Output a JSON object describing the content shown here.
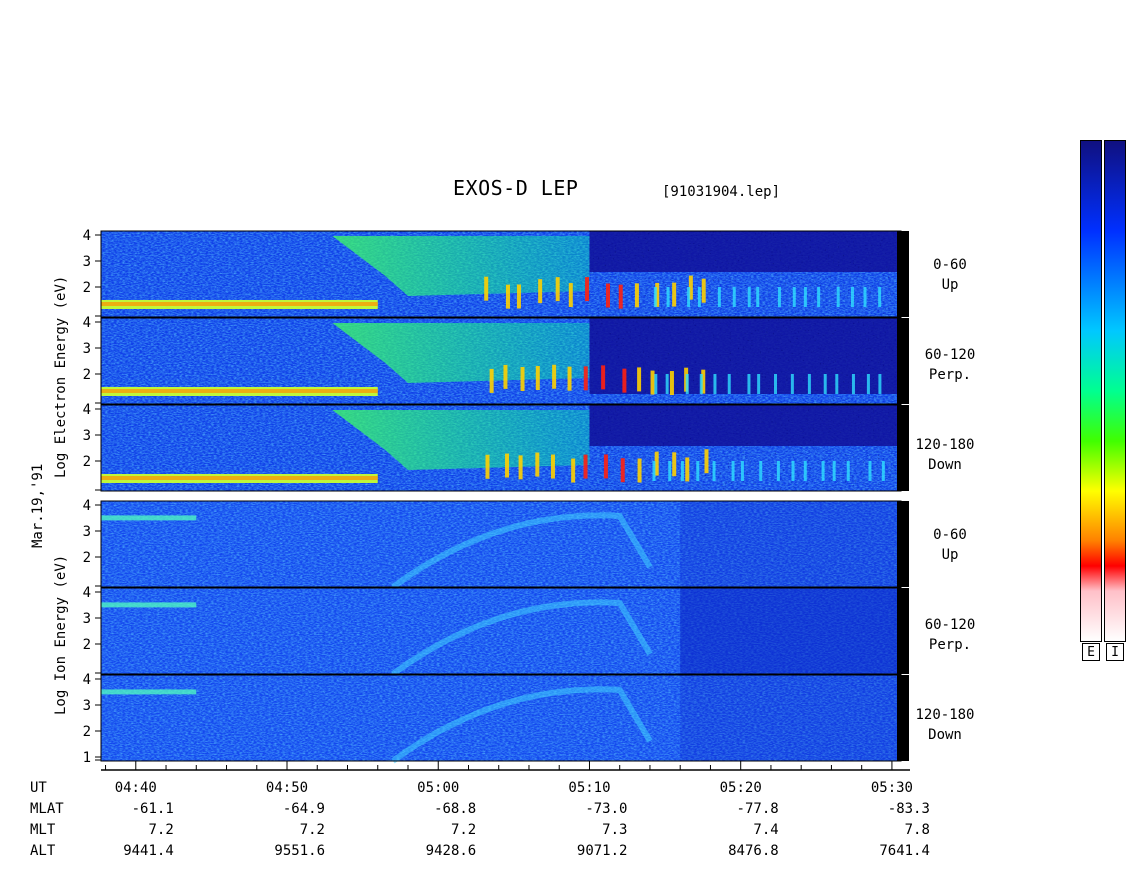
{
  "title": "EXOS-D LEP",
  "subtitle": "[91031904.lep]",
  "date_label": "Mar.19,'91",
  "electron_ylabel": [
    "Log",
    "Electron",
    "Energy",
    "(eV)"
  ],
  "ion_ylabel": [
    "Log",
    "Ion",
    "Energy",
    "(eV)"
  ],
  "colorbar": {
    "labels": [
      "E",
      "I"
    ],
    "colors": [
      "#101080",
      "#0000ff",
      "#00c8ff",
      "#00ff80",
      "#40ff00",
      "#ffff00",
      "#ff8000",
      "#ff0000",
      "#ffd0d0",
      "#ffffff"
    ]
  },
  "panels": [
    {
      "group": "Electron",
      "angle": [
        "0-60",
        "Up"
      ]
    },
    {
      "group": "Electron",
      "angle": [
        "60-120",
        "Perp."
      ]
    },
    {
      "group": "Electron",
      "angle": [
        "120-180",
        "Down"
      ]
    },
    {
      "group": "Ion",
      "angle": [
        "0-60",
        "Up"
      ]
    },
    {
      "group": "Ion",
      "angle": [
        "60-120",
        "Perp."
      ]
    },
    {
      "group": "Ion",
      "angle": [
        "120-180",
        "Down"
      ]
    }
  ],
  "chart_data": {
    "type": "heatmap",
    "xlabel": "UT",
    "ylim": [
      1,
      4
    ],
    "yticks": [
      "4",
      "3",
      "2"
    ],
    "ion_yticks": [
      "4",
      "3",
      "2",
      "1"
    ],
    "ephemeris_rows": [
      "UT",
      "MLAT",
      "MLT",
      "ALT"
    ],
    "ephemeris": [
      {
        "UT": "04:40",
        "MLAT": "-61.1",
        "MLT": "7.2",
        "ALT": "9441.4"
      },
      {
        "UT": "04:50",
        "MLAT": "-64.9",
        "MLT": "7.2",
        "ALT": "9551.6"
      },
      {
        "UT": "05:00",
        "MLAT": "-68.8",
        "MLT": "7.2",
        "ALT": "9428.6"
      },
      {
        "UT": "05:10",
        "MLAT": "-73.0",
        "MLT": "7.3",
        "ALT": "9071.2"
      },
      {
        "UT": "05:20",
        "MLAT": "-77.8",
        "MLT": "7.4",
        "ALT": "8476.8"
      },
      {
        "UT": "05:30",
        "MLAT": "-83.3",
        "MLT": "7.8",
        "ALT": "7641.4"
      }
    ]
  }
}
